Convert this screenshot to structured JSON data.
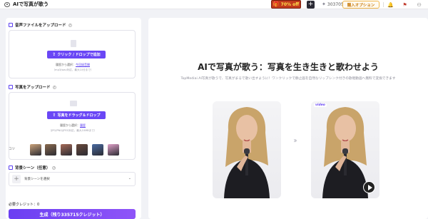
{
  "topbar": {
    "app_title": "AIで写真が歌う",
    "promo": "70% off",
    "credits_count": "303705",
    "buy_label": "購入オプション"
  },
  "upload_audio": {
    "title": "音声ファイルをアップロード",
    "button_label": "クリック / ドロップで追加",
    "history_label": "履歴から選択：",
    "history_link": "今回録音開",
    "hint": "（mp3/wav対応、最大10分まで）"
  },
  "upload_photo": {
    "title": "写真をアップロード",
    "button_label": "写真をドラッグ＆ドロップ",
    "history_label": "履歴から選択：",
    "history_link": "履歴",
    "hint": "（JPG/PNG/JPEG対応、最大10MBまで）"
  },
  "samples": {
    "label": "コツ",
    "thumb_colors": [
      "#caa27a",
      "#8a6b4e",
      "#a56b58",
      "#6a4a3c",
      "#4a6ba0",
      "#e0a0c8"
    ]
  },
  "background": {
    "title": "背景シーン（任意）",
    "select_text": "背景シーンを選択"
  },
  "footer": {
    "credit_text": "必要クレジット：0",
    "generate_label": "生成（残り335715クレジット）"
  },
  "main": {
    "headline": "AIで写真が歌う：写真を生き生きと歌わせよう",
    "subtitle": "TopMediai AI写真が歌うで、写真がまるで歌い出すように！ワンクリックで静止画を自然なリップシンク付きの歌唱動画へ無料で変換できます",
    "video_tag": "video"
  },
  "colors": {
    "accent": "#6a47f5",
    "promo_bg": "#c23b1e"
  }
}
